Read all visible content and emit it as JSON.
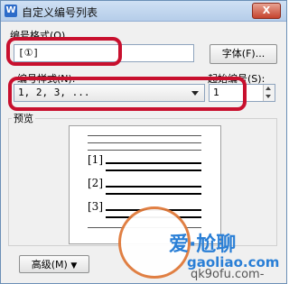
{
  "window": {
    "title": "自定义编号列表",
    "close_symbol": "X",
    "app_icon_glyph": "W"
  },
  "number_format": {
    "label": "编号格式(O)",
    "value": "[①]"
  },
  "font_button": {
    "label": "字体(F)..."
  },
  "number_style": {
    "label": "编号样式(N):",
    "selected": "1, 2, 3, ..."
  },
  "start_at": {
    "label": "起始编号(S):",
    "value": "1"
  },
  "preview": {
    "label": "预览",
    "items": [
      "[1]",
      "[2]",
      "[3]"
    ]
  },
  "advanced_button": {
    "label": "高级(M)",
    "arrow": "▼"
  },
  "watermark": {
    "line1": "爱·尬聊",
    "line2": "gaoliao.com",
    "line3": "qk9ofu.com-"
  },
  "colors": {
    "highlight": "#c8102e",
    "titlebar": "#b5cde9",
    "watermark": "#2a7fd6"
  }
}
